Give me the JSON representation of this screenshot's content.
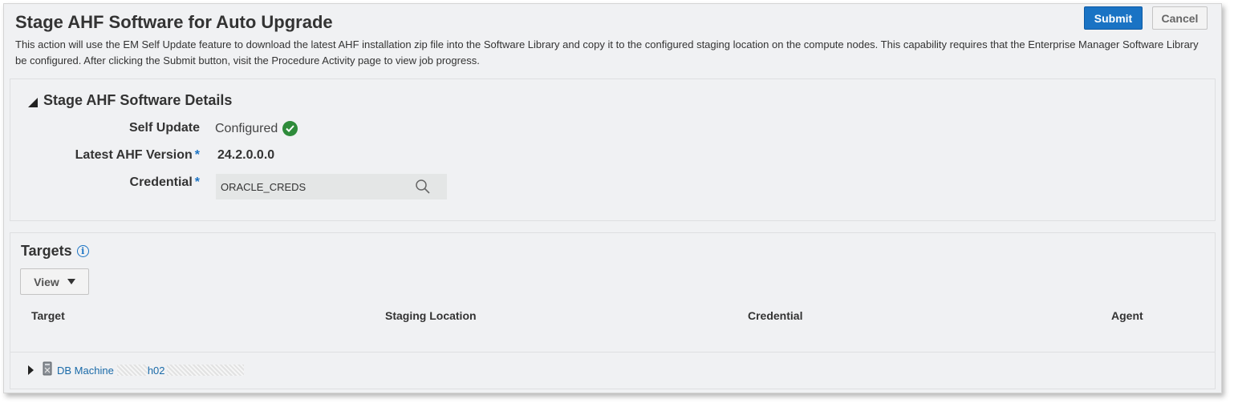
{
  "header": {
    "title": "Stage AHF Software for Auto Upgrade",
    "description": "This action will use the EM Self Update feature to download the latest AHF installation zip file into the Software Library and copy it to the configured staging location on the compute nodes. This capability requires that the Enterprise Manager Software Library be configured. After clicking the Submit button, visit the Procedure Activity page to view job progress.",
    "submit_label": "Submit",
    "cancel_label": "Cancel"
  },
  "details": {
    "section_title": "Stage AHF Software Details",
    "self_update_label": "Self Update",
    "self_update_value": "Configured",
    "ahf_version_label": "Latest AHF Version",
    "ahf_version_value": "24.2.0.0.0",
    "credential_label": "Credential",
    "credential_value": "ORACLE_CREDS",
    "required_marker": "*"
  },
  "targets": {
    "title": "Targets",
    "view_label": "View",
    "columns": [
      "Target",
      "Staging Location",
      "Credential",
      "Agent"
    ],
    "rows": [
      {
        "target_prefix": "DB Machine",
        "target_visible_fragment": "h02"
      }
    ]
  },
  "colors": {
    "primary_button": "#1a73c4",
    "success": "#2e8b3a",
    "link": "#1a6aa8",
    "panel_bg": "#f0f1f3"
  },
  "icons": [
    "check-circle-icon",
    "search-icon",
    "info-icon",
    "caret-down-icon",
    "expand-triangle-icon",
    "database-machine-icon",
    "collapse-triangle-icon"
  ]
}
